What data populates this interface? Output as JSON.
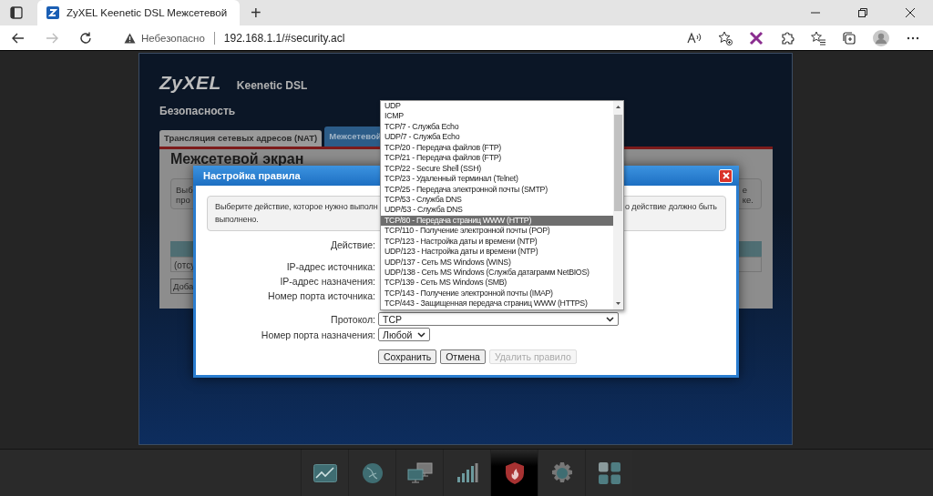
{
  "browser": {
    "tab_title": "ZyXEL Keenetic DSL Межсетевой",
    "new_tab": "+",
    "security_label": "Небезопасно",
    "url": "192.168.1.1/#security.acl"
  },
  "router": {
    "logo": "ZyXEL",
    "model": "Keenetic DSL",
    "section": "Безопасность",
    "tabs": [
      {
        "label": "Трансляция сетевых адресов (NAT)",
        "selected": false
      },
      {
        "label": "Межсетевой",
        "selected": true
      }
    ],
    "heading": "Межсетевой экран",
    "info_left": [
      "Выб",
      "про"
    ],
    "info_right": [
      "е",
      "ке."
    ],
    "table_row": "(отсу",
    "add_button": "Доба"
  },
  "dialog": {
    "title": "Настройка правила",
    "info_left": "Выберите действие, которое нужно выполн",
    "info_right": "о действие должно быть",
    "info_line2": "выполнено.",
    "fields": [
      {
        "label": "Действие:",
        "kind": "label"
      },
      {
        "label": "IP-адрес источника:",
        "kind": "label"
      },
      {
        "label": "IP-адрес назначения:",
        "kind": "label"
      },
      {
        "label": "Номер порта источника:",
        "kind": "label"
      },
      {
        "label": "Протокол:",
        "kind": "wide_select",
        "value": "TCP"
      },
      {
        "label": "Номер порта назначения:",
        "kind": "select",
        "value": "Любой"
      }
    ],
    "buttons": [
      {
        "label": "Сохранить",
        "disabled": false
      },
      {
        "label": "Отмена",
        "disabled": false
      },
      {
        "label": "Удалить правило",
        "disabled": true
      }
    ],
    "dropdown": {
      "options": [
        {
          "label": "UDP",
          "selected": false
        },
        {
          "label": "ICMP",
          "selected": false
        },
        {
          "label": "TCP/7 - Служба Echo",
          "selected": false
        },
        {
          "label": "UDP/7 - Служба Echo",
          "selected": false
        },
        {
          "label": "TCP/20 - Передача файлов (FTP)",
          "selected": false
        },
        {
          "label": "TCP/21 - Передача файлов (FTP)",
          "selected": false
        },
        {
          "label": "TCP/22 - Secure Shell (SSH)",
          "selected": false
        },
        {
          "label": "TCP/23 - Удаленный терминал (Telnet)",
          "selected": false
        },
        {
          "label": "TCP/25 - Передача электронной почты (SMTP)",
          "selected": false
        },
        {
          "label": "TCP/53 - Служба DNS",
          "selected": false
        },
        {
          "label": "UDP/53 - Служба DNS",
          "selected": false
        },
        {
          "label": "TCP/80 - Передача страниц WWW (HTTP)",
          "selected": true
        },
        {
          "label": "TCP/110 - Получение электронной почты (POP)",
          "selected": false
        },
        {
          "label": "TCP/123 - Настройка даты и времени (NTP)",
          "selected": false
        },
        {
          "label": "UDP/123 - Настройка даты и времени (NTP)",
          "selected": false
        },
        {
          "label": "UDP/137 - Сеть MS Windows (WINS)",
          "selected": false
        },
        {
          "label": "UDP/138 - Сеть MS Windows (Служба датаграмм NetBIOS)",
          "selected": false
        },
        {
          "label": "TCP/139 - Сеть MS Windows (SMB)",
          "selected": false
        },
        {
          "label": "TCP/143 - Получение электронной почты (IMAP)",
          "selected": false
        },
        {
          "label": "TCP/443 - Защищенная передача страниц WWW (HTTPS)",
          "selected": false
        }
      ]
    }
  },
  "bottom_nav": {
    "items": [
      {
        "kind": "chart",
        "selected": false
      },
      {
        "kind": "globe",
        "selected": false
      },
      {
        "kind": "network",
        "selected": false
      },
      {
        "kind": "signal",
        "selected": false
      },
      {
        "kind": "shield",
        "selected": true
      },
      {
        "kind": "gear",
        "selected": false
      },
      {
        "kind": "apps",
        "selected": false
      }
    ]
  }
}
